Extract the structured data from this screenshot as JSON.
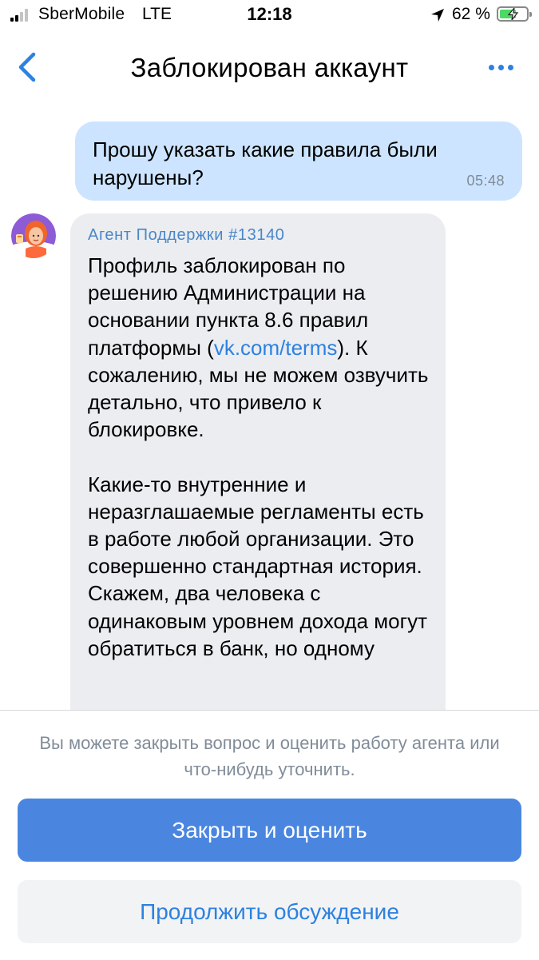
{
  "status_bar": {
    "carrier": "SberMobile",
    "network": "LTE",
    "time": "12:18",
    "battery_percent": "62 %",
    "battery_level": 0.62,
    "icons": [
      "signal-icon",
      "location-icon",
      "battery-icon",
      "charging-bolt-icon"
    ]
  },
  "navbar": {
    "title": "Заблокирован аккаунт",
    "icons": [
      "back-chevron-icon",
      "more-dots-icon"
    ],
    "accent_color": "#2d81e0"
  },
  "messages": {
    "outgoing": {
      "text": "Прошу указать какие правила были нарушены?",
      "time": "05:48",
      "bubble_color": "#cce4ff"
    },
    "incoming": {
      "sender": "Агент Поддержки #13140",
      "avatar_icon": "support-agent-avatar-icon",
      "part1": "Профиль заблокирован по решению Администрации на основании пункта 8.6 правил платформы (",
      "link": "vk.com/terms",
      "part2": "). К сожалению, мы не можем озвучить детально, что привело к блокировке.",
      "paragraph2": "Какие-то внутренние и неразглашаемые регламенты есть в работе любой организации. Это совершенно стандартная история. Скажем, два человека с одинаковым уровнем дохода могут обратиться в банк, но одному",
      "bubble_color": "#ebedf0"
    }
  },
  "bottom_panel": {
    "hint": "Вы можете закрыть вопрос и оценить работу агента или что-нибудь уточнить.",
    "primary_button": "Закрыть и оценить",
    "secondary_button": "Продолжить обсуждение",
    "primary_color": "#4a86e0"
  }
}
